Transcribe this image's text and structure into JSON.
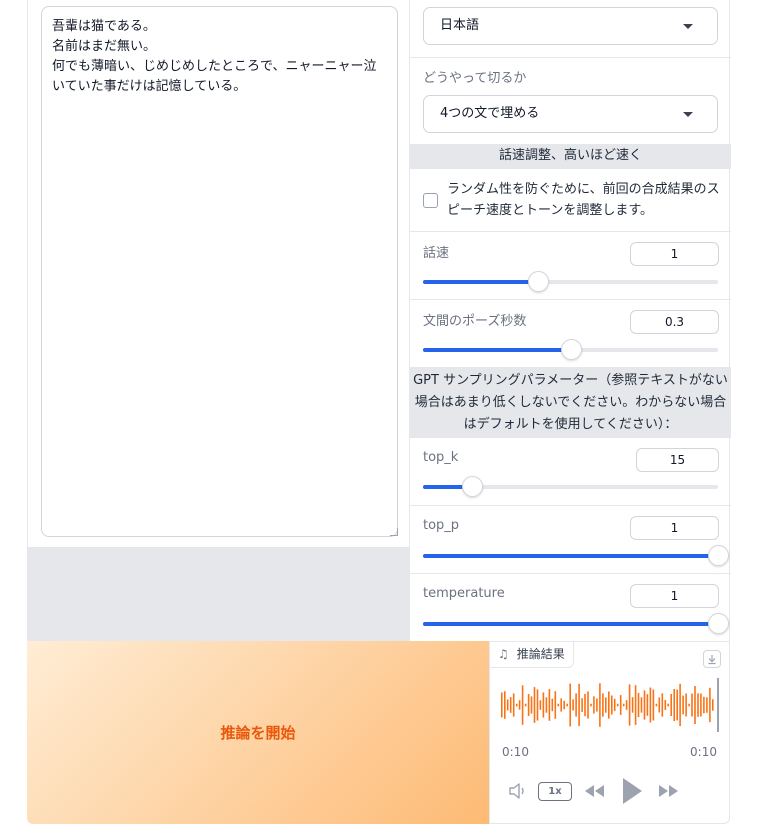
{
  "text_input": {
    "value": "吾輩は猫である。\n名前はまだ無い。\n何でも薄暗い、じめじめしたところで、ニャーニャー泣いていた事だけは記憶している。"
  },
  "settings": {
    "language_select": {
      "value": "日本語"
    },
    "split": {
      "label": "どうやって切るか",
      "value": "4つの文で埋める"
    },
    "speed_header": "話速調整、高いほど速く",
    "checkbox": {
      "label": "ランダム性を防ぐために、前回の合成結果のスピーチ速度とトーンを調整します。",
      "checked": false
    },
    "speed": {
      "label": "話速",
      "value": "1",
      "fraction": 0.39
    },
    "pause": {
      "label": "文間のポーズ秒数",
      "value": "0.3",
      "fraction": 0.5
    },
    "gpt_header": "GPT サンプリングパラメーター（参照テキストがない場合はあまり低くしないでください。わからない場合はデフォルトを使用してください）：",
    "top_k": {
      "label": "top_k",
      "value": "15",
      "fraction": 0.167
    },
    "top_p": {
      "label": "top_p",
      "value": "1",
      "fraction": 1.0
    },
    "temperature": {
      "label": "temperature",
      "value": "1",
      "fraction": 1.0
    }
  },
  "start_button": {
    "label": "推論を開始"
  },
  "audio": {
    "label": "推論結果",
    "time_current": "0:10",
    "time_total": "0:10",
    "rate": "1x"
  },
  "colors": {
    "accent": "#2563eb",
    "start_text": "#ea580c",
    "wave": "#f97316"
  },
  "icons": [
    "chevron-down-icon",
    "music-note-icon",
    "download-icon",
    "volume-icon",
    "rewind-icon",
    "play-icon",
    "fast-forward-icon"
  ]
}
